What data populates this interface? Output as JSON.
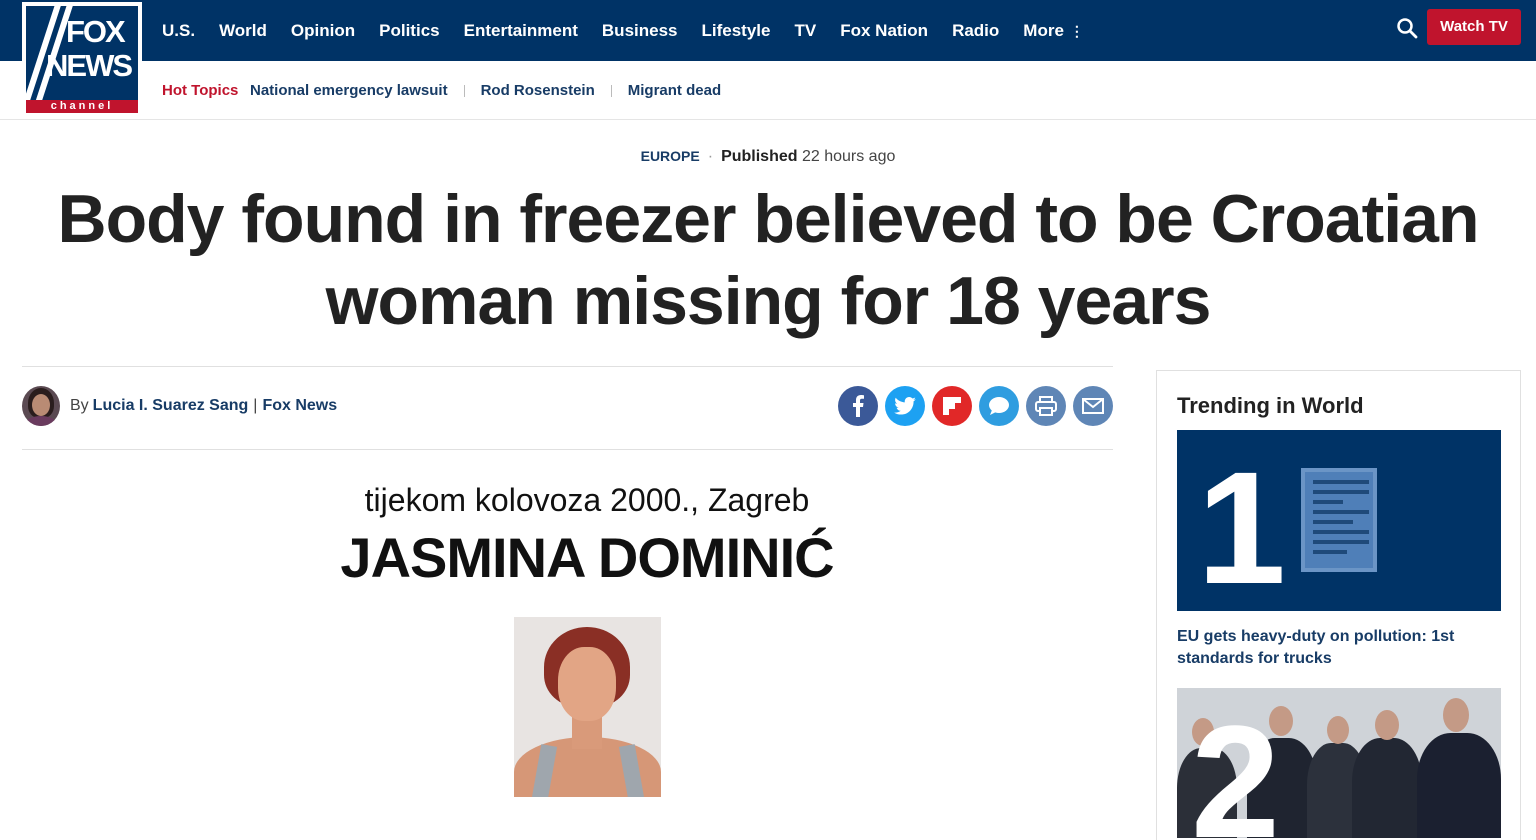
{
  "logo": {
    "line1": "FOX",
    "line2": "NEWS",
    "line3": "channel"
  },
  "nav": {
    "items": [
      "U.S.",
      "World",
      "Opinion",
      "Politics",
      "Entertainment",
      "Business",
      "Lifestyle",
      "TV",
      "Fox Nation",
      "Radio",
      "More"
    ],
    "more_dots": "⋮",
    "watch_label": "Watch TV"
  },
  "hot_topics": {
    "label": "Hot Topics",
    "links": [
      "National emergency lawsuit",
      "Rod Rosenstein",
      "Migrant dead"
    ]
  },
  "article": {
    "category": "EUROPE",
    "published_label": "Published",
    "published_time": "22 hours ago",
    "headline": "Body found in freezer believed to be Croatian woman missing for 18 years",
    "byline_prefix": "By",
    "author": "Lucia I. Suarez Sang",
    "byline_sep": "|",
    "outlet": "Fox News",
    "image_text_line1": "tijekom kolovoza 2000., Zagreb",
    "image_text_line2": "JASMINA DOMINIĆ"
  },
  "share": [
    {
      "name": "facebook",
      "glyph": "f",
      "color": "#3b5998"
    },
    {
      "name": "twitter",
      "glyph": "t",
      "color": "#1da1f2"
    },
    {
      "name": "flipboard",
      "glyph": "F",
      "color": "#e12828"
    },
    {
      "name": "comments",
      "glyph": "💬",
      "color": "#2f9de0"
    },
    {
      "name": "print",
      "glyph": "⎙",
      "color": "#5f86b6"
    },
    {
      "name": "email",
      "glyph": "✉",
      "color": "#5f86b6"
    }
  ],
  "sidebar": {
    "title": "Trending in World",
    "items": [
      {
        "rank": "1",
        "title": "EU gets heavy-duty on pollution: 1st standards for trucks"
      },
      {
        "rank": "2",
        "title": ""
      }
    ]
  },
  "colors": {
    "navy": "#003366",
    "red": "#c0142d",
    "link": "#183c66"
  }
}
